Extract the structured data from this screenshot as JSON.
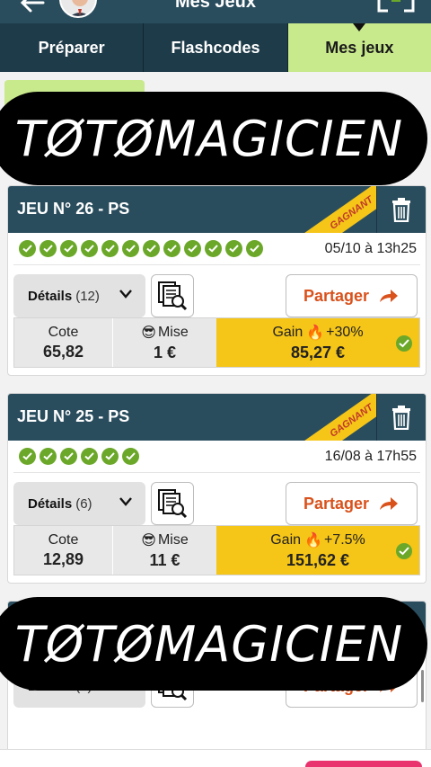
{
  "header": {
    "title": "Mes Jeux"
  },
  "tabs": [
    {
      "label": "Préparer",
      "active": false
    },
    {
      "label": "Flashcodes",
      "active": false
    },
    {
      "label": "Mes jeux",
      "active": true
    }
  ],
  "watermark": {
    "text": "TØTØMAGICIEN"
  },
  "cards": [
    {
      "title": "JEU N° 26 - PS",
      "ribbon": "GAGNANT",
      "checks": 12,
      "date": "05/10 à 13h25",
      "details_label": "Détails",
      "details_count": "(12)",
      "share_label": "Partager",
      "cote_label": "Cote",
      "cote_value": "65,82",
      "mise_label": "Mise",
      "mise_value": "1 €",
      "gain_label": "Gain",
      "gain_bonus": "+30%",
      "gain_value": "85,27 €"
    },
    {
      "title": "JEU N° 25 - PS",
      "ribbon": "GAGNANT",
      "checks": 6,
      "date": "16/08 à 17h55",
      "details_label": "Détails",
      "details_count": "(6)",
      "share_label": "Partager",
      "cote_label": "Cote",
      "cote_value": "12,89",
      "mise_label": "Mise",
      "mise_value": "11 €",
      "gain_label": "Gain",
      "gain_bonus": "+7.5%",
      "gain_value": "151,62 €"
    },
    {
      "details_label": "Détails",
      "details_count": "(8)",
      "share_label": "Partager"
    }
  ],
  "colors": {
    "header_bg": "#2a4d5e",
    "tab_active_bg": "#c8e98c",
    "win_green": "#6ba82a",
    "gain_yellow": "#f5c518",
    "share_orange": "#d9521c"
  }
}
